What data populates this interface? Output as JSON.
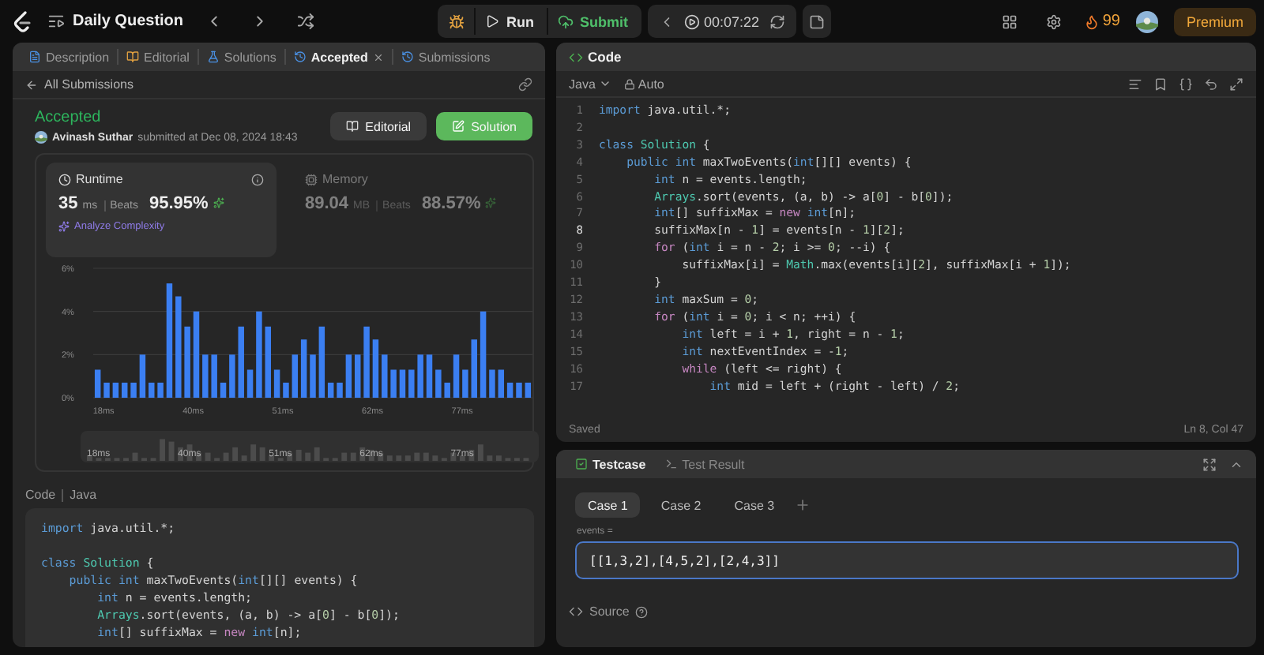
{
  "top_bar": {
    "title": "Daily Question",
    "run_label": "Run",
    "submit_label": "Submit",
    "timer": "00:07:22",
    "streak": "99",
    "premium_label": "Premium"
  },
  "left_panel": {
    "tabs": [
      {
        "label": "Description",
        "kind": "description",
        "selected": false,
        "closable": false
      },
      {
        "label": "Editorial",
        "kind": "editorial",
        "selected": false,
        "closable": false
      },
      {
        "label": "Solutions",
        "kind": "solutions",
        "selected": false,
        "closable": false
      },
      {
        "label": "Accepted",
        "kind": "accepted",
        "selected": true,
        "closable": true
      },
      {
        "label": "Submissions",
        "kind": "submissions",
        "selected": false,
        "closable": false
      }
    ],
    "back_link": "All Submissions",
    "submission": {
      "status": "Accepted",
      "author": "Avinash Suthar",
      "submitted_text": "submitted at Dec 08, 2024 18:43",
      "buttons": [
        {
          "label": "Editorial",
          "kind": "secondary"
        },
        {
          "label": "Solution",
          "kind": "primary"
        }
      ]
    },
    "stats": [
      {
        "kind": "runtime",
        "label": "Runtime",
        "value": "35",
        "unit": "ms",
        "beats_label": "Beats",
        "percent": "95.95%",
        "selected": true,
        "analyze_label": "Analyze Complexity"
      },
      {
        "kind": "memory",
        "label": "Memory",
        "value": "89.04",
        "unit": "MB",
        "beats_label": "Beats",
        "percent": "88.57%",
        "selected": false
      }
    ],
    "chart_data": {
      "type": "bar",
      "ylim": [
        0,
        6
      ],
      "yticks": [
        {
          "value": 0,
          "label": "0%"
        },
        {
          "value": 2,
          "label": "2%"
        },
        {
          "value": 4,
          "label": "4%"
        },
        {
          "value": 6,
          "label": "6%"
        }
      ],
      "categories": [
        "18ms",
        null,
        null,
        null,
        null,
        null,
        null,
        null,
        null,
        null,
        "40ms",
        null,
        null,
        null,
        null,
        null,
        null,
        null,
        null,
        null,
        "51ms",
        null,
        null,
        null,
        null,
        null,
        null,
        null,
        null,
        null,
        "62ms",
        null,
        null,
        null,
        null,
        null,
        null,
        null,
        null,
        null,
        "77ms",
        null,
        null,
        null,
        null,
        null,
        null,
        null,
        null
      ],
      "series": [
        {
          "color": "#3b7ff2",
          "values": [
            1.3,
            0.7,
            0.7,
            0.7,
            0.7,
            2,
            0.7,
            0.7,
            5.3,
            4.7,
            3.3,
            4,
            2,
            2,
            0.7,
            2,
            3.3,
            1.3,
            4,
            3.3,
            1.3,
            0.7,
            2,
            2.7,
            2,
            3.3,
            0.7,
            0.7,
            2,
            2,
            3.3,
            2.7,
            2,
            1.3,
            1.3,
            1.3,
            2,
            2,
            1.3,
            0.7,
            2,
            1.3,
            2.7,
            4,
            1.3,
            1.3,
            0.7,
            0.7,
            0.7
          ]
        }
      ]
    },
    "overview_labels": [
      "18ms",
      "40ms",
      "51ms",
      "62ms",
      "77ms"
    ],
    "code_section": {
      "title": "Code",
      "language": "Java",
      "lines": [
        {
          "kind": "code",
          "tokens": [
            {
              "kind": "kw",
              "text": "import"
            },
            {
              "kind": "pl",
              "text": " java.util.*;"
            }
          ]
        },
        {
          "kind": "blank"
        },
        {
          "kind": "code",
          "tokens": [
            {
              "kind": "kw",
              "text": "class "
            },
            {
              "kind": "ty",
              "text": "Solution"
            },
            {
              "kind": "pl",
              "text": " {"
            }
          ]
        },
        {
          "kind": "code",
          "tokens": [
            {
              "kind": "kw",
              "text": "    public int"
            },
            {
              "kind": "pl",
              "text": " maxTwoEvents("
            },
            {
              "kind": "kw",
              "text": "int"
            },
            {
              "kind": "pl",
              "text": "[][] events) {"
            }
          ]
        },
        {
          "kind": "code",
          "tokens": [
            {
              "kind": "kw",
              "text": "        int"
            },
            {
              "kind": "pl",
              "text": " n = events.length;"
            }
          ]
        },
        {
          "kind": "code",
          "tokens": [
            {
              "kind": "ty",
              "text": "        Arrays"
            },
            {
              "kind": "pl",
              "text": ".sort(events, (a, b) -> a["
            },
            {
              "kind": "num",
              "text": "0"
            },
            {
              "kind": "pl",
              "text": "] - b["
            },
            {
              "kind": "num",
              "text": "0"
            },
            {
              "kind": "pl",
              "text": "]);"
            }
          ]
        },
        {
          "kind": "code",
          "tokens": [
            {
              "kind": "kw",
              "text": "        int"
            },
            {
              "kind": "pl",
              "text": "[] suffixMax = "
            },
            {
              "kind": "ctl",
              "text": "new "
            },
            {
              "kind": "kw",
              "text": "int"
            },
            {
              "kind": "pl",
              "text": "[n];"
            }
          ]
        }
      ]
    }
  },
  "editor": {
    "title": "Code",
    "language": "Java",
    "mode": "Auto",
    "status": "Saved",
    "cursor": "Ln 8, Col 47",
    "lines": [
      {
        "number": "1",
        "current": false,
        "tokens": [
          {
            "kind": "kw",
            "text": "import"
          },
          {
            "kind": "pl",
            "text": " java.util.*;"
          }
        ]
      },
      {
        "number": "2",
        "current": false
      },
      {
        "number": "3",
        "current": false,
        "tokens": [
          {
            "kind": "kw",
            "text": "class "
          },
          {
            "kind": "ty",
            "text": "Solution"
          },
          {
            "kind": "pl",
            "text": " {"
          }
        ]
      },
      {
        "number": "4",
        "current": false,
        "tokens": [
          {
            "kind": "kw",
            "text": "    public int"
          },
          {
            "kind": "pl",
            "text": " maxTwoEvents("
          },
          {
            "kind": "kw",
            "text": "int"
          },
          {
            "kind": "pl",
            "text": "[][] events) {"
          }
        ]
      },
      {
        "number": "5",
        "current": false,
        "tokens": [
          {
            "kind": "kw",
            "text": "        int"
          },
          {
            "kind": "pl",
            "text": " n = events.length;"
          }
        ]
      },
      {
        "number": "6",
        "current": false,
        "tokens": [
          {
            "kind": "ty",
            "text": "        Arrays"
          },
          {
            "kind": "pl",
            "text": ".sort(events, (a, b) -> a["
          },
          {
            "kind": "num",
            "text": "0"
          },
          {
            "kind": "pl",
            "text": "] - b["
          },
          {
            "kind": "num",
            "text": "0"
          },
          {
            "kind": "pl",
            "text": "]);"
          }
        ]
      },
      {
        "number": "7",
        "current": false,
        "tokens": [
          {
            "kind": "kw",
            "text": "        int"
          },
          {
            "kind": "pl",
            "text": "[] suffixMax = "
          },
          {
            "kind": "ctl",
            "text": "new "
          },
          {
            "kind": "kw",
            "text": "int"
          },
          {
            "kind": "pl",
            "text": "[n];"
          }
        ]
      },
      {
        "number": "8",
        "current": true,
        "tokens": [
          {
            "kind": "pl",
            "text": "        suffixMax[n - "
          },
          {
            "kind": "num",
            "text": "1"
          },
          {
            "kind": "pl",
            "text": "] = events[n - "
          },
          {
            "kind": "num",
            "text": "1"
          },
          {
            "kind": "pl",
            "text": "]["
          },
          {
            "kind": "num",
            "text": "2"
          },
          {
            "kind": "pl",
            "text": "];"
          }
        ]
      },
      {
        "number": "9",
        "current": false,
        "tokens": [
          {
            "kind": "ctl",
            "text": "        for"
          },
          {
            "kind": "pl",
            "text": " ("
          },
          {
            "kind": "kw",
            "text": "int"
          },
          {
            "kind": "pl",
            "text": " i = n - "
          },
          {
            "kind": "num",
            "text": "2"
          },
          {
            "kind": "pl",
            "text": "; i >= "
          },
          {
            "kind": "num",
            "text": "0"
          },
          {
            "kind": "pl",
            "text": "; --i) {"
          }
        ]
      },
      {
        "number": "10",
        "current": false,
        "tokens": [
          {
            "kind": "pl",
            "text": "            suffixMax[i] = "
          },
          {
            "kind": "ty",
            "text": "Math"
          },
          {
            "kind": "pl",
            "text": ".max(events[i]["
          },
          {
            "kind": "num",
            "text": "2"
          },
          {
            "kind": "pl",
            "text": "], suffixMax[i + "
          },
          {
            "kind": "num",
            "text": "1"
          },
          {
            "kind": "pl",
            "text": "]);"
          }
        ]
      },
      {
        "number": "11",
        "current": false,
        "tokens": [
          {
            "kind": "pl",
            "text": "        }"
          }
        ]
      },
      {
        "number": "12",
        "current": false,
        "tokens": [
          {
            "kind": "kw",
            "text": "        int"
          },
          {
            "kind": "pl",
            "text": " maxSum = "
          },
          {
            "kind": "num",
            "text": "0"
          },
          {
            "kind": "pl",
            "text": ";"
          }
        ]
      },
      {
        "number": "13",
        "current": false,
        "tokens": [
          {
            "kind": "ctl",
            "text": "        for"
          },
          {
            "kind": "pl",
            "text": " ("
          },
          {
            "kind": "kw",
            "text": "int"
          },
          {
            "kind": "pl",
            "text": " i = "
          },
          {
            "kind": "num",
            "text": "0"
          },
          {
            "kind": "pl",
            "text": "; i < n; ++i) {"
          }
        ]
      },
      {
        "number": "14",
        "current": false,
        "tokens": [
          {
            "kind": "kw",
            "text": "            int"
          },
          {
            "kind": "pl",
            "text": " left = i + "
          },
          {
            "kind": "num",
            "text": "1"
          },
          {
            "kind": "pl",
            "text": ", right = n - "
          },
          {
            "kind": "num",
            "text": "1"
          },
          {
            "kind": "pl",
            "text": ";"
          }
        ]
      },
      {
        "number": "15",
        "current": false,
        "tokens": [
          {
            "kind": "kw",
            "text": "            int"
          },
          {
            "kind": "pl",
            "text": " nextEventIndex = -"
          },
          {
            "kind": "num",
            "text": "1"
          },
          {
            "kind": "pl",
            "text": ";"
          }
        ]
      },
      {
        "number": "16",
        "current": false,
        "tokens": [
          {
            "kind": "ctl",
            "text": "            while"
          },
          {
            "kind": "pl",
            "text": " (left <= right) {"
          }
        ]
      },
      {
        "number": "17",
        "current": false,
        "tokens": [
          {
            "kind": "kw",
            "text": "                int"
          },
          {
            "kind": "pl",
            "text": " mid = left + (right - left) / "
          },
          {
            "kind": "num",
            "text": "2"
          },
          {
            "kind": "pl",
            "text": ";"
          }
        ]
      }
    ]
  },
  "testcase": {
    "tabs": [
      {
        "label": "Testcase",
        "kind": "testcase",
        "selected": true
      },
      {
        "label": "Test Result",
        "kind": "result",
        "selected": false
      }
    ],
    "cases": [
      {
        "label": "Case 1",
        "selected": true
      },
      {
        "label": "Case 2",
        "selected": false
      },
      {
        "label": "Case 3",
        "selected": false
      }
    ],
    "param_label": "events =",
    "param_value": "[[1,3,2],[4,5,2],[2,4,3]]",
    "source_label": "Source"
  }
}
